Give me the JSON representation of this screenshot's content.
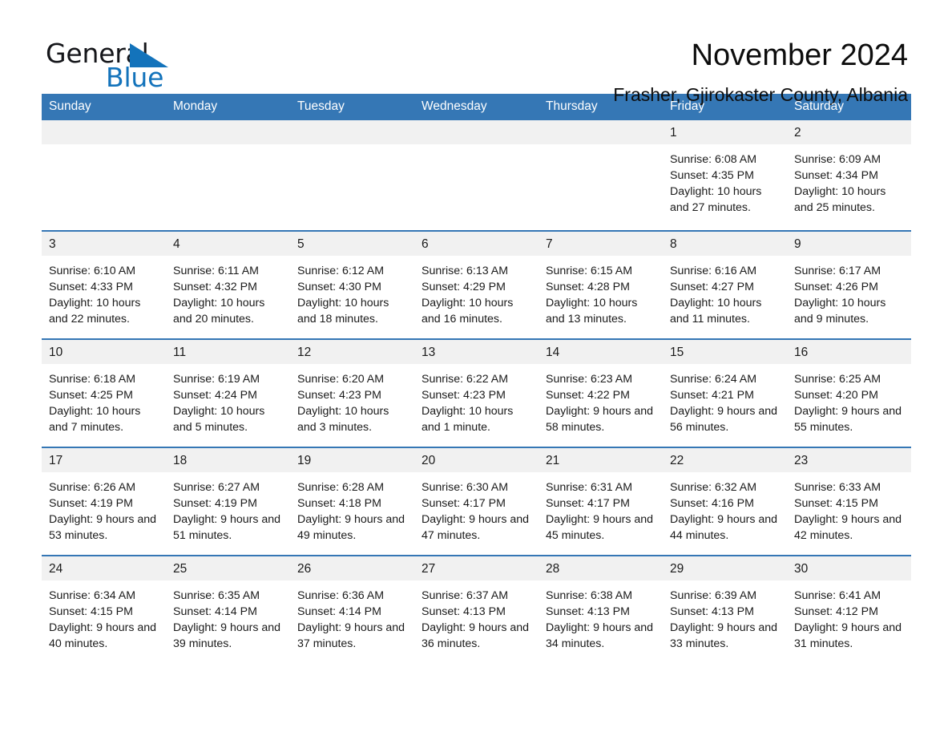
{
  "brand": {
    "word_one": "General",
    "word_two": "Blue",
    "triangle_color": "#1373bb",
    "text_color": "#15161a"
  },
  "header": {
    "month_title": "November 2024",
    "location": "Frasher, Gjirokaster County, Albania"
  },
  "theme": {
    "header_blue": "#3577b5",
    "daynum_band": "#f1f1f1",
    "text": "#1a1a1a",
    "page_background": "#ffffff"
  },
  "calendar": {
    "weekday_headers": [
      "Sunday",
      "Monday",
      "Tuesday",
      "Wednesday",
      "Thursday",
      "Friday",
      "Saturday"
    ],
    "labels": {
      "sunrise": "Sunrise:",
      "sunset": "Sunset:",
      "daylight": "Daylight:"
    },
    "weeks": [
      [
        {
          "day": "",
          "sunrise": "",
          "sunset": "",
          "daylight": ""
        },
        {
          "day": "",
          "sunrise": "",
          "sunset": "",
          "daylight": ""
        },
        {
          "day": "",
          "sunrise": "",
          "sunset": "",
          "daylight": ""
        },
        {
          "day": "",
          "sunrise": "",
          "sunset": "",
          "daylight": ""
        },
        {
          "day": "",
          "sunrise": "",
          "sunset": "",
          "daylight": ""
        },
        {
          "day": "1",
          "sunrise": "Sunrise: 6:08 AM",
          "sunset": "Sunset: 4:35 PM",
          "daylight": "Daylight: 10 hours and 27 minutes."
        },
        {
          "day": "2",
          "sunrise": "Sunrise: 6:09 AM",
          "sunset": "Sunset: 4:34 PM",
          "daylight": "Daylight: 10 hours and 25 minutes."
        }
      ],
      [
        {
          "day": "3",
          "sunrise": "Sunrise: 6:10 AM",
          "sunset": "Sunset: 4:33 PM",
          "daylight": "Daylight: 10 hours and 22 minutes."
        },
        {
          "day": "4",
          "sunrise": "Sunrise: 6:11 AM",
          "sunset": "Sunset: 4:32 PM",
          "daylight": "Daylight: 10 hours and 20 minutes."
        },
        {
          "day": "5",
          "sunrise": "Sunrise: 6:12 AM",
          "sunset": "Sunset: 4:30 PM",
          "daylight": "Daylight: 10 hours and 18 minutes."
        },
        {
          "day": "6",
          "sunrise": "Sunrise: 6:13 AM",
          "sunset": "Sunset: 4:29 PM",
          "daylight": "Daylight: 10 hours and 16 minutes."
        },
        {
          "day": "7",
          "sunrise": "Sunrise: 6:15 AM",
          "sunset": "Sunset: 4:28 PM",
          "daylight": "Daylight: 10 hours and 13 minutes."
        },
        {
          "day": "8",
          "sunrise": "Sunrise: 6:16 AM",
          "sunset": "Sunset: 4:27 PM",
          "daylight": "Daylight: 10 hours and 11 minutes."
        },
        {
          "day": "9",
          "sunrise": "Sunrise: 6:17 AM",
          "sunset": "Sunset: 4:26 PM",
          "daylight": "Daylight: 10 hours and 9 minutes."
        }
      ],
      [
        {
          "day": "10",
          "sunrise": "Sunrise: 6:18 AM",
          "sunset": "Sunset: 4:25 PM",
          "daylight": "Daylight: 10 hours and 7 minutes."
        },
        {
          "day": "11",
          "sunrise": "Sunrise: 6:19 AM",
          "sunset": "Sunset: 4:24 PM",
          "daylight": "Daylight: 10 hours and 5 minutes."
        },
        {
          "day": "12",
          "sunrise": "Sunrise: 6:20 AM",
          "sunset": "Sunset: 4:23 PM",
          "daylight": "Daylight: 10 hours and 3 minutes."
        },
        {
          "day": "13",
          "sunrise": "Sunrise: 6:22 AM",
          "sunset": "Sunset: 4:23 PM",
          "daylight": "Daylight: 10 hours and 1 minute."
        },
        {
          "day": "14",
          "sunrise": "Sunrise: 6:23 AM",
          "sunset": "Sunset: 4:22 PM",
          "daylight": "Daylight: 9 hours and 58 minutes."
        },
        {
          "day": "15",
          "sunrise": "Sunrise: 6:24 AM",
          "sunset": "Sunset: 4:21 PM",
          "daylight": "Daylight: 9 hours and 56 minutes."
        },
        {
          "day": "16",
          "sunrise": "Sunrise: 6:25 AM",
          "sunset": "Sunset: 4:20 PM",
          "daylight": "Daylight: 9 hours and 55 minutes."
        }
      ],
      [
        {
          "day": "17",
          "sunrise": "Sunrise: 6:26 AM",
          "sunset": "Sunset: 4:19 PM",
          "daylight": "Daylight: 9 hours and 53 minutes."
        },
        {
          "day": "18",
          "sunrise": "Sunrise: 6:27 AM",
          "sunset": "Sunset: 4:19 PM",
          "daylight": "Daylight: 9 hours and 51 minutes."
        },
        {
          "day": "19",
          "sunrise": "Sunrise: 6:28 AM",
          "sunset": "Sunset: 4:18 PM",
          "daylight": "Daylight: 9 hours and 49 minutes."
        },
        {
          "day": "20",
          "sunrise": "Sunrise: 6:30 AM",
          "sunset": "Sunset: 4:17 PM",
          "daylight": "Daylight: 9 hours and 47 minutes."
        },
        {
          "day": "21",
          "sunrise": "Sunrise: 6:31 AM",
          "sunset": "Sunset: 4:17 PM",
          "daylight": "Daylight: 9 hours and 45 minutes."
        },
        {
          "day": "22",
          "sunrise": "Sunrise: 6:32 AM",
          "sunset": "Sunset: 4:16 PM",
          "daylight": "Daylight: 9 hours and 44 minutes."
        },
        {
          "day": "23",
          "sunrise": "Sunrise: 6:33 AM",
          "sunset": "Sunset: 4:15 PM",
          "daylight": "Daylight: 9 hours and 42 minutes."
        }
      ],
      [
        {
          "day": "24",
          "sunrise": "Sunrise: 6:34 AM",
          "sunset": "Sunset: 4:15 PM",
          "daylight": "Daylight: 9 hours and 40 minutes."
        },
        {
          "day": "25",
          "sunrise": "Sunrise: 6:35 AM",
          "sunset": "Sunset: 4:14 PM",
          "daylight": "Daylight: 9 hours and 39 minutes."
        },
        {
          "day": "26",
          "sunrise": "Sunrise: 6:36 AM",
          "sunset": "Sunset: 4:14 PM",
          "daylight": "Daylight: 9 hours and 37 minutes."
        },
        {
          "day": "27",
          "sunrise": "Sunrise: 6:37 AM",
          "sunset": "Sunset: 4:13 PM",
          "daylight": "Daylight: 9 hours and 36 minutes."
        },
        {
          "day": "28",
          "sunrise": "Sunrise: 6:38 AM",
          "sunset": "Sunset: 4:13 PM",
          "daylight": "Daylight: 9 hours and 34 minutes."
        },
        {
          "day": "29",
          "sunrise": "Sunrise: 6:39 AM",
          "sunset": "Sunset: 4:13 PM",
          "daylight": "Daylight: 9 hours and 33 minutes."
        },
        {
          "day": "30",
          "sunrise": "Sunrise: 6:41 AM",
          "sunset": "Sunset: 4:12 PM",
          "daylight": "Daylight: 9 hours and 31 minutes."
        }
      ]
    ]
  }
}
